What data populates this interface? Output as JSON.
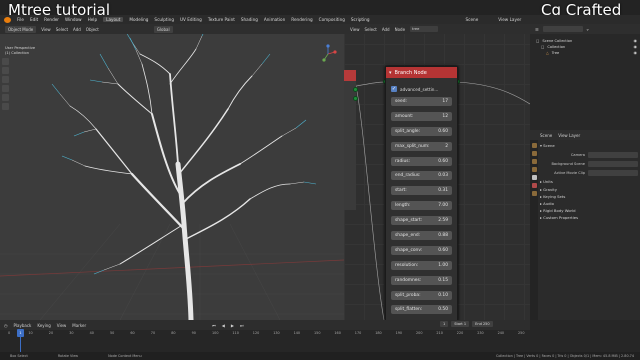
{
  "overlay": {
    "left_title": "Mtree tutorial",
    "right_title": "Cg Crafted"
  },
  "menubar": {
    "menus": [
      "File",
      "Edit",
      "Render",
      "Window",
      "Help"
    ],
    "workspaces": [
      "Layout",
      "Modeling",
      "Sculpting",
      "UV Editing",
      "Texture Paint",
      "Shading",
      "Animation",
      "Rendering",
      "Compositing",
      "Scripting"
    ],
    "active_workspace": "Layout",
    "scene_label": "Scene",
    "view_layer_label": "View Layer"
  },
  "viewport": {
    "mode": "Object Mode",
    "menus": [
      "View",
      "Select",
      "Add",
      "Object"
    ],
    "transform": "Global",
    "view_name": "User Perspective",
    "collection": "(1) Collection"
  },
  "node_editor": {
    "menus": [
      "View",
      "Select",
      "Add",
      "Node"
    ],
    "tree_name": "tree",
    "node": {
      "title": "Branch Node",
      "checkbox_label": "advanced_settin...",
      "checkbox_checked": true,
      "properties": [
        {
          "label": "seed:",
          "value": "17"
        },
        {
          "label": "amount:",
          "value": "12"
        },
        {
          "label": "split_angle:",
          "value": "0.60"
        },
        {
          "label": "max_split_num:",
          "value": "2"
        },
        {
          "label": "radius:",
          "value": "0.60"
        },
        {
          "label": "end_radius:",
          "value": "0.03"
        },
        {
          "label": "start:",
          "value": "0.31"
        },
        {
          "label": "length:",
          "value": "7.00"
        },
        {
          "label": "shape_start:",
          "value": "2.59"
        },
        {
          "label": "shape_end:",
          "value": "0.88"
        },
        {
          "label": "shape_conv:",
          "value": "0.60"
        },
        {
          "label": "resolution:",
          "value": "1.00"
        },
        {
          "label": "randomnes:",
          "value": "0.15"
        },
        {
          "label": "split_proba:",
          "value": "0.10"
        },
        {
          "label": "split_flatten:",
          "value": "0.50"
        },
        {
          "label": "gravity_stre:",
          "value": "0.30"
        },
        {
          "label": "floor_avoida:",
          "value": "1.00"
        }
      ]
    }
  },
  "outliner": {
    "items": [
      {
        "label": "Scene Collection"
      },
      {
        "label": "Collection"
      },
      {
        "label": "Tree"
      }
    ]
  },
  "properties": {
    "tabs": [
      "Scene",
      "View Layer"
    ],
    "sections": {
      "scene": "Scene",
      "fields": [
        {
          "label": "Camera",
          "value": ""
        },
        {
          "label": "Background Scene",
          "value": ""
        },
        {
          "label": "Active Movie Clip",
          "value": ""
        }
      ],
      "units": "Units",
      "gravity": "Gravity",
      "keying_sets": "Keying Sets",
      "audio": "Audio",
      "rigid_body": "Rigid Body World",
      "custom_props": "Custom Properties"
    }
  },
  "timeline": {
    "menus": [
      "Playback",
      "Keying",
      "View",
      "Marker"
    ],
    "current_frame": "1",
    "start_label": "Start",
    "start_value": "1",
    "end_label": "End",
    "end_value": "250",
    "ruler": [
      "0",
      "10",
      "20",
      "30",
      "40",
      "50",
      "60",
      "70",
      "80",
      "90",
      "100",
      "110",
      "120",
      "130",
      "140",
      "150",
      "160",
      "170",
      "180",
      "190",
      "200",
      "210",
      "220",
      "230",
      "240",
      "250"
    ]
  },
  "statusbar": {
    "select": "Box Select",
    "rotate": "Rotate View",
    "context": "Node Context Menu",
    "stats": "Collection | Tree | Verts 0 | Faces 0 | Tris 0 | Objects 0/1 | Mem: 45.8 MiB | 2.80.74"
  },
  "colors": {
    "node_header": "#b53434",
    "socket": "#1e8f3a",
    "branch_white": "#e6e6e6",
    "branch_cyan": "#4fb7d4"
  }
}
